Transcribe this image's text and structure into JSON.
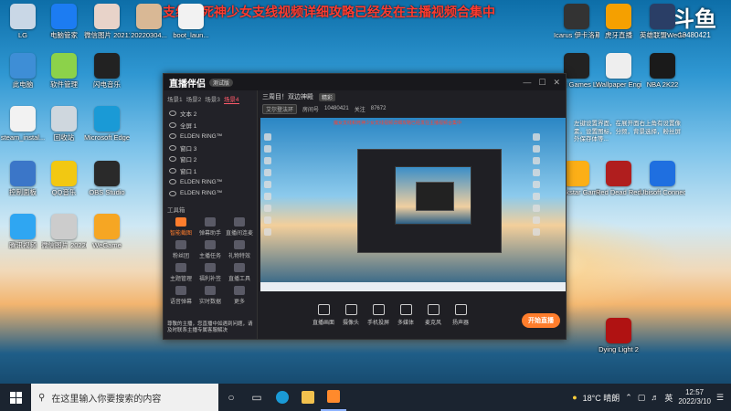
{
  "banner": "魔女支线和死神少女支线视频详细攻略已经发在主播视频合集中",
  "watermark": {
    "logo": "斗鱼",
    "room": "10480421"
  },
  "desktop": {
    "left_icons": [
      {
        "label": "LG",
        "color": "#c9d7e6"
      },
      {
        "label": "电脑管家",
        "color": "#1c7cf2"
      },
      {
        "label": "微信图片 2021122...",
        "color": "#e8d3c9"
      },
      {
        "label": "20220304...",
        "color": "#d9b895"
      },
      {
        "label": "boot_laun...",
        "color": "#f2f2f2"
      },
      {
        "label": "此电脑",
        "color": "#3e8ed6"
      },
      {
        "label": "软件管理",
        "color": "#8cd24a"
      },
      {
        "label": "闪电音乐",
        "color": "#222"
      },
      {
        "label": "Network",
        "color": "#3b82d4"
      },
      {
        "label": "网易UU加速器",
        "color": "#1b2c44"
      },
      {
        "label": "steam_instal...",
        "color": "#f2f2f2"
      },
      {
        "label": "回收站",
        "color": "#cfd7de"
      },
      {
        "label": "Microsoft Edge",
        "color": "#1a9ad6"
      },
      {
        "label": "GeForce Experience",
        "color": "#6bb020"
      },
      {
        "label": "20220304...",
        "color": "#7a5a3a"
      },
      {
        "label": "控制面板",
        "color": "#3b76c8"
      },
      {
        "label": "QQ音乐",
        "color": "#f2c812"
      },
      {
        "label": "OBS Studio",
        "color": "#2a2a2a"
      },
      {
        "label": "剪映专业版",
        "color": "#111"
      },
      {
        "label": "英雄联盟",
        "color": "#c79b3a"
      },
      {
        "label": "腾讯视频",
        "color": "#2fa6f2"
      },
      {
        "label": "微信图片 2022022...",
        "color": "#cccccc"
      },
      {
        "label": "WeGame",
        "color": "#f6a623"
      },
      {
        "label": "腾讯游戏平台",
        "color": "#f0c030"
      },
      {
        "label": "腾讯QQ",
        "color": "#2fa6f2"
      }
    ],
    "right_icons": [
      {
        "label": "Icarus 伊卡洛斯",
        "color": "#333"
      },
      {
        "label": "虎牙直播",
        "color": "#f5a000"
      },
      {
        "label": "英雄联盟WeGame版",
        "color": "#2a3e66"
      },
      {
        "label": "Epic Games Launcher",
        "color": "#222"
      },
      {
        "label": "Wallpaper Engine",
        "color": "#eeeeee"
      },
      {
        "label": "NBA 2K22",
        "color": "#1a1a1a"
      },
      {
        "label": "Rockstar Games Launcher",
        "color": "#fcaf17"
      },
      {
        "label": "Red Dead Redemption 2",
        "color": "#b01e1e"
      },
      {
        "label": "Ubisoft Connect",
        "color": "#1f6fe0"
      },
      {
        "label": "Dying Light 2",
        "color": "#b01212"
      }
    ],
    "right_note": "左键设置界面，在展开面右上角有设置像素。设置图标，分频，背景选择，粉丝屏外保存体等..."
  },
  "app": {
    "logo": "直播伴侣",
    "version": "测试版",
    "window_buttons": [
      "—",
      "☐",
      "✕"
    ],
    "scene_tabs": [
      "场景1",
      "场景2",
      "场景3",
      "场景4"
    ],
    "active_scene": 3,
    "sources": [
      "文本 2",
      "全屏 1",
      "ELDEN RING™",
      "窗口 3",
      "窗口 2",
      "窗口 1",
      "ELDEN RING™",
      "ELDEN RING™"
    ],
    "tools_title": "工具箱",
    "tools": [
      {
        "label": "智能截图",
        "hot": true
      },
      {
        "label": "弹幕助手",
        "hot": false
      },
      {
        "label": "直播间连麦",
        "hot": false
      },
      {
        "label": "粉丝团",
        "hot": false
      },
      {
        "label": "主播任务",
        "hot": false
      },
      {
        "label": "礼物特效",
        "hot": false
      },
      {
        "label": "主题管理",
        "hot": false
      },
      {
        "label": "福利补签",
        "hot": false
      },
      {
        "label": "直播工具",
        "hot": false
      },
      {
        "label": "语音弹幕",
        "hot": false
      },
      {
        "label": "实时数据",
        "hot": false
      },
      {
        "label": "更多",
        "hot": false
      }
    ],
    "alert_text": "尊敬的主播，您直播中如遇到问题，请及时联系主播专属客服解决",
    "room_title": "三周目！双边神殿",
    "room_badge": "精彩",
    "meta": {
      "category": "艾尔登法环",
      "room_label": "房间号",
      "room": "10480421",
      "followers_label": "关注",
      "followers": "87672"
    },
    "preview_banner": "魔女支线和死神少女支线视频详细攻略已经发在主播视频合集中",
    "controls": [
      "直播画面",
      "摄像头",
      "手机投屏",
      "多媒体",
      "麦克风",
      "扬声器"
    ],
    "start_label": "开始直播"
  },
  "taskbar": {
    "search_placeholder": "在这里输入你要搜索的内容",
    "weather": "18°C 晴朗",
    "ime": "英",
    "time": "12:57",
    "date": "2022/3/10"
  }
}
